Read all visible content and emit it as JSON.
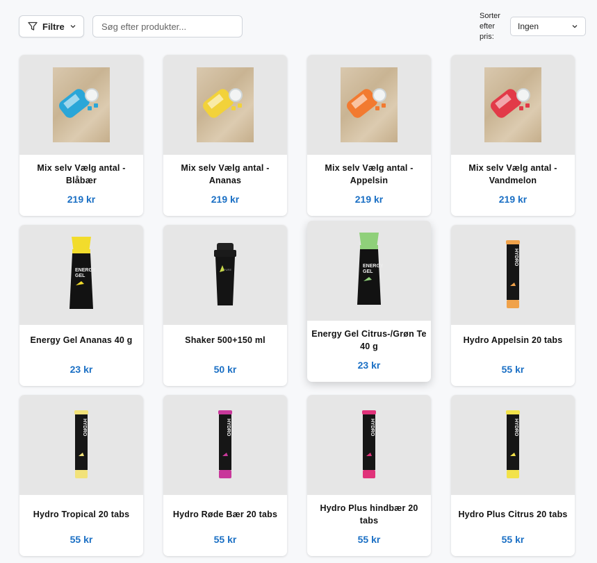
{
  "toolbar": {
    "filter_label": "Filtre",
    "search_placeholder": "Søg efter produkter...",
    "sort_label": "Sorter efter pris:",
    "sort_value": "Ingen"
  },
  "products": [
    {
      "name": "Mix selv Vælg antal - Blåbær",
      "price": "219 kr",
      "kind": "photo",
      "color": "#2aa6d8"
    },
    {
      "name": "Mix selv Vælg antal - Ananas",
      "price": "219 kr",
      "kind": "photo",
      "color": "#f2d23a"
    },
    {
      "name": "Mix selv Vælg antal - Appelsin",
      "price": "219 kr",
      "kind": "photo",
      "color": "#f27a30"
    },
    {
      "name": "Mix selv Vælg antal - Vandmelon",
      "price": "219 kr",
      "kind": "photo",
      "color": "#e23a48"
    },
    {
      "name": "Energy Gel Ananas 40 g",
      "price": "23 kr",
      "kind": "gel",
      "color": "#f2dc2c"
    },
    {
      "name": "Shaker 500+150 ml",
      "price": "50 kr",
      "kind": "shaker",
      "color": "#1a1a1a"
    },
    {
      "name": "Energy Gel Citrus-/Grøn Te 40 g",
      "price": "23 kr",
      "kind": "gel",
      "color": "#8fd07a"
    },
    {
      "name": "Hydro Appelsin 20 tabs",
      "price": "55 kr",
      "kind": "tube",
      "color": "#f0a24a"
    },
    {
      "name": "Hydro Tropical 20 tabs",
      "price": "55 kr",
      "kind": "tube",
      "color": "#f2e27a"
    },
    {
      "name": "Hydro Røde Bær 20 tabs",
      "price": "55 kr",
      "kind": "tube",
      "color": "#c8389a"
    },
    {
      "name": "Hydro Plus hindbær 20 tabs",
      "price": "55 kr",
      "kind": "tube",
      "color": "#e0337a"
    },
    {
      "name": "Hydro Plus Citrus 20 tabs",
      "price": "55 kr",
      "kind": "tube",
      "color": "#f2e24a"
    }
  ]
}
